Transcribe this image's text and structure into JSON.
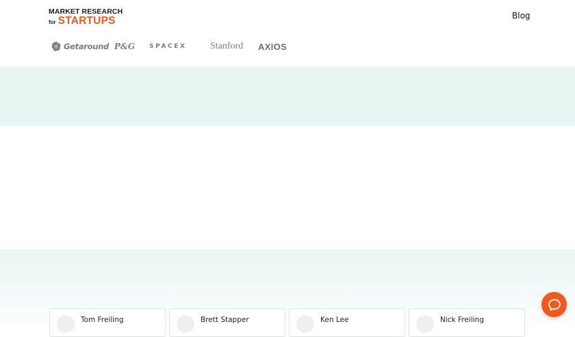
{
  "brand": {
    "line1": "MARKET RESEARCH",
    "for": "for",
    "line2": "STARTUPS",
    "accent": "#ef5b1c"
  },
  "nav": {
    "blog": "Blog"
  },
  "clients": [
    "Getaround",
    "P&G",
    "SPACEX",
    "Stanford",
    "AXIOS"
  ],
  "band_color": "#e9f5f3",
  "founders": [
    {
      "name": "Tom Freiling"
    },
    {
      "name": "Brett Stapper"
    },
    {
      "name": "Ken Lee"
    },
    {
      "name": "Nick Freiling"
    }
  ],
  "chat": {
    "icon": "chat-bubble-icon"
  }
}
